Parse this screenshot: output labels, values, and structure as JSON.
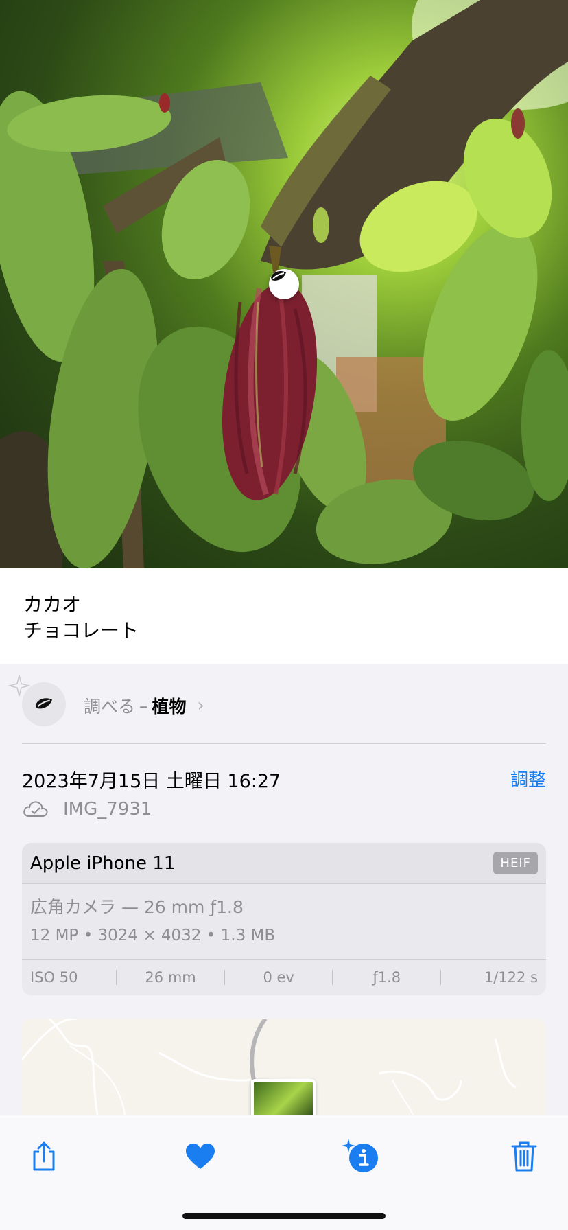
{
  "photo": {
    "subject": "cacao pod on tree"
  },
  "caption": {
    "line1": "カカオ",
    "line2": "チョコレート"
  },
  "lookup": {
    "prefix": "調べる",
    "dash": "–",
    "category": "植物",
    "chevron": "›"
  },
  "info": {
    "datetime": "2023年7月15日 土曜日 16:27",
    "adjust_label": "調整",
    "filename": "IMG_7931"
  },
  "camera": {
    "model": "Apple iPhone 11",
    "format_badge": "HEIF",
    "lens": "広角カメラ — 26 mm ƒ1.8",
    "specs": "12 MP • 3024 × 4032 • 1.3 MB",
    "exif": [
      "ISO 50",
      "26 mm",
      "0 ev",
      "ƒ1.8",
      "1/122 s"
    ]
  },
  "toolbar": {
    "share_icon": "share-icon",
    "favorite_icon": "heart-icon",
    "info_icon": "info-sparkle-icon",
    "delete_icon": "trash-icon"
  },
  "colors": {
    "accent": "#1a7ef0",
    "secondary_text": "#8e8e93",
    "background": "#f2f2f7"
  }
}
